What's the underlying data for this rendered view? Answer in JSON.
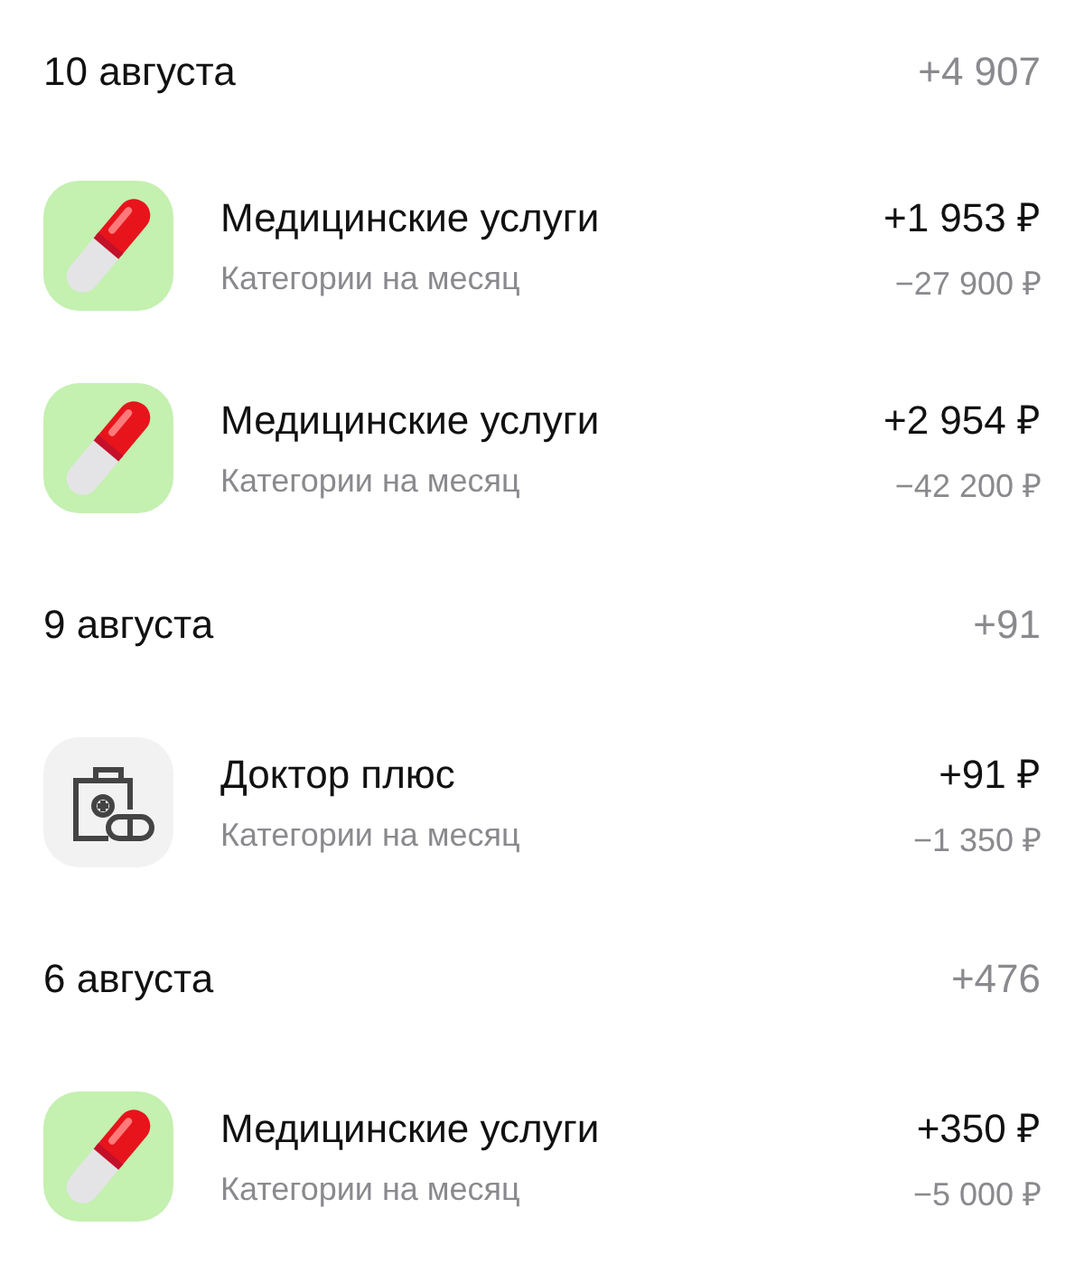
{
  "groups": [
    {
      "date": "10 августа",
      "total": "+4 907",
      "items": [
        {
          "kind": "pill",
          "title": "Медицинские услуги",
          "subtitle": "Категории на месяц",
          "amount": "+1 953 ₽",
          "budget": "−27 900 ₽"
        },
        {
          "kind": "pill",
          "title": "Медицинские услуги",
          "subtitle": "Категории на месяц",
          "amount": "+2 954 ₽",
          "budget": "−42 200 ₽"
        }
      ]
    },
    {
      "date": "9 августа",
      "total": "+91",
      "items": [
        {
          "kind": "kit",
          "title": "Доктор плюс",
          "subtitle": "Категории на месяц",
          "amount": "+91 ₽",
          "budget": "−1 350 ₽"
        }
      ]
    },
    {
      "date": "6 августа",
      "total": "+476",
      "items": [
        {
          "kind": "pill",
          "title": "Медицинские услуги",
          "subtitle": "Категории на месяц",
          "amount": "+350 ₽",
          "budget": "−5 000 ₽"
        }
      ]
    }
  ]
}
